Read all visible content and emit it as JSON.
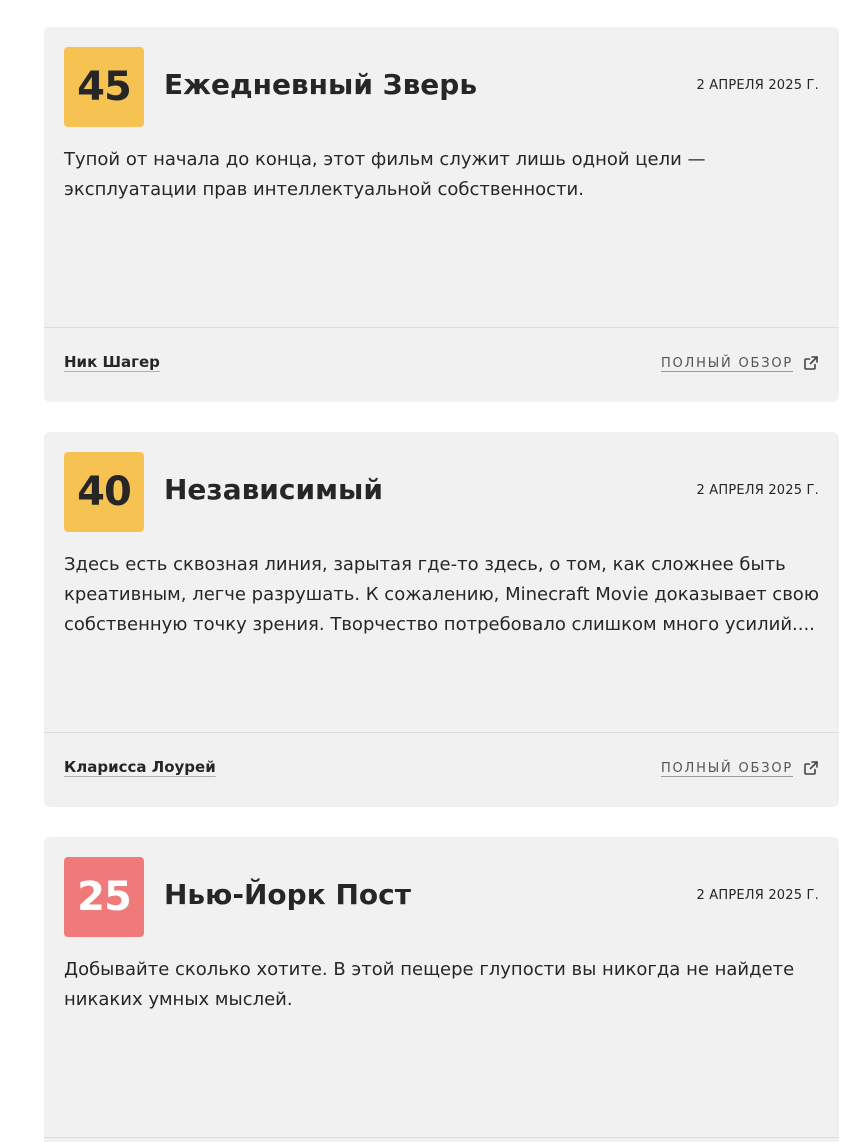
{
  "reviews": [
    {
      "score": "45",
      "score_color": "#f6c352",
      "publication": "Ежедневный Зверь",
      "date": "2 АПРЕЛЯ 2025 Г.",
      "quote": "Тупой от начала до конца, этот фильм служит лишь одной цели — эксплуатации прав интеллектуальной собственности.",
      "critic": "Ник Шагер",
      "link_label": "ПОЛНЫЙ ОБЗОР",
      "link_icon": "external-link-icon"
    },
    {
      "score": "40",
      "score_color": "#f6c352",
      "publication": "Независимый",
      "date": "2 АПРЕЛЯ 2025 Г.",
      "quote": "Здесь есть сквозная линия, зарытая где-то здесь, о том, как сложнее быть креативным, легче разрушать. К сожалению, Minecraft Movie доказывает свою собственную точку зрения. Творчество потребовало слишком много усилий....",
      "critic": "Кларисса Лоурей",
      "link_label": "ПОЛНЫЙ ОБЗОР",
      "link_icon": "external-link-icon"
    },
    {
      "score": "25",
      "score_color": "#f07a7a",
      "publication": "Нью-Йорк Пост",
      "date": "2 АПРЕЛЯ 2025 Г.",
      "quote": "Добывайте сколько хотите. В этой пещере глупости вы никогда не найдете никаких умных мыслей."
    }
  ]
}
